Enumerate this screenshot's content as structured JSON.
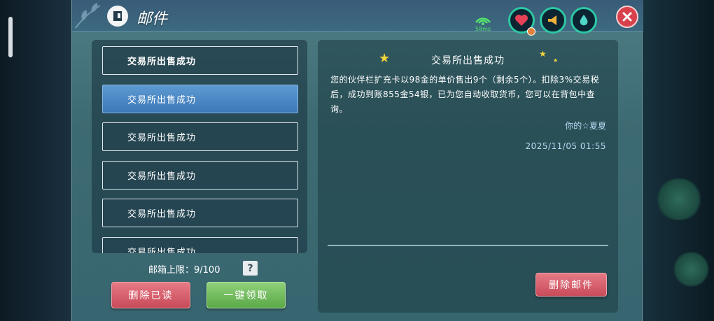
{
  "window": {
    "title": "邮件",
    "ping_label": "58ms"
  },
  "mail_list": {
    "items": [
      {
        "subject": "交易所出售成功"
      },
      {
        "subject": "交易所出售成功"
      },
      {
        "subject": "交易所出售成功"
      },
      {
        "subject": "交易所出售成功"
      },
      {
        "subject": "交易所出售成功"
      },
      {
        "subject": "交易所出售成功"
      }
    ],
    "selected_index": 1,
    "limit_label": "邮箱上限：9/100",
    "help_label": "?"
  },
  "actions": {
    "delete_read_label": "删除已读",
    "claim_all_label": "一键领取",
    "delete_mail_label": "删除邮件"
  },
  "detail": {
    "title": "交易所出售成功",
    "body": "您的伙伴栏扩充卡以98金的单价售出9个（剩余5个）。扣除3%交易税后，成功到账855金54银，已为您自动收取货币，您可以在背包中查询。",
    "sender": "你的☆夏夏",
    "date": "2025/11/05 01:55"
  },
  "icons": {
    "title_icon": "mail-icon",
    "status": [
      "heart-icon",
      "trumpet-icon",
      "water-drop-icon"
    ],
    "close": "close-icon",
    "ping": "wifi-signal-icon"
  },
  "colors": {
    "accent_selected": "#4a87c4",
    "button_red": "#d45c69",
    "button_green": "#6cb857",
    "ping_green": "#53e36a",
    "status_ring": "#2cc7a4"
  }
}
